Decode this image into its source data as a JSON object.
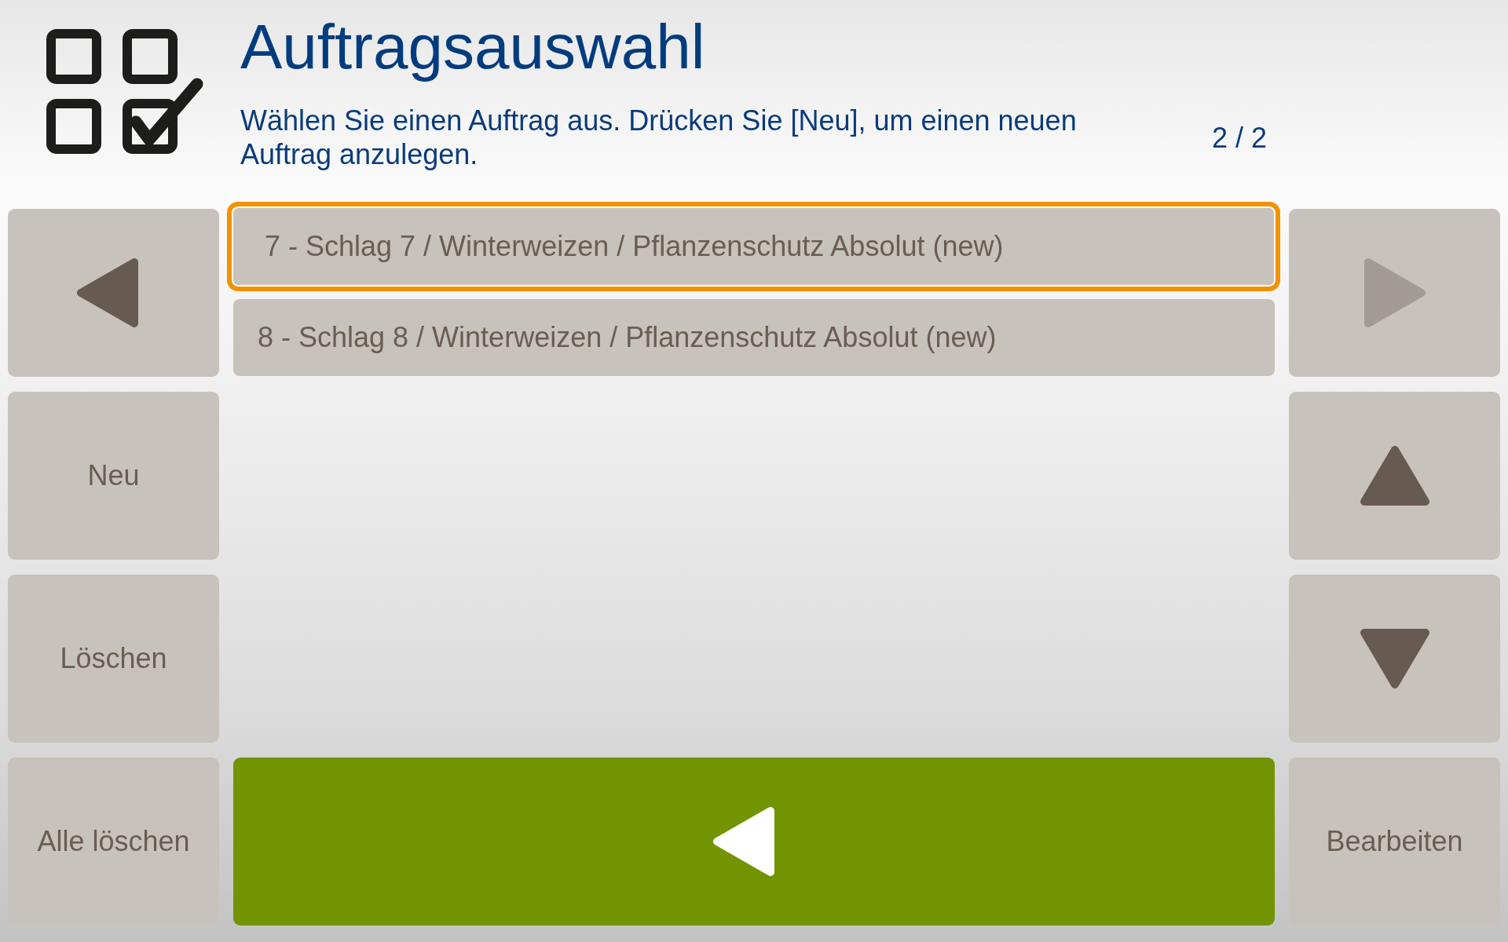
{
  "header": {
    "title": "Auftragsauswahl",
    "instruction": "Wählen Sie einen Auftrag aus. Drücken Sie [Neu], um einen neuen Auftrag anzulegen.",
    "page_indicator": "2 / 2"
  },
  "left_buttons": [
    {
      "kind": "arrow-left",
      "disabled": false
    },
    {
      "kind": "text",
      "label": "Neu",
      "disabled": false
    },
    {
      "kind": "text",
      "label": "Löschen",
      "disabled": false
    },
    {
      "kind": "text",
      "label": "Alle löschen",
      "disabled": false
    }
  ],
  "orders": [
    {
      "label": "7 - Schlag 7 / Winterweizen / Pflanzenschutz Absolut (new)",
      "selected": true
    },
    {
      "label": "8 - Schlag 8 / Winterweizen / Pflanzenschutz Absolut (new)",
      "selected": false
    }
  ],
  "confirm_button": {
    "kind": "arrow-left"
  },
  "right_buttons": [
    {
      "kind": "arrow-right",
      "disabled": true
    },
    {
      "kind": "arrow-up",
      "disabled": false
    },
    {
      "kind": "arrow-down",
      "disabled": false
    },
    {
      "kind": "text",
      "label": "Bearbeiten",
      "disabled": false
    }
  ]
}
